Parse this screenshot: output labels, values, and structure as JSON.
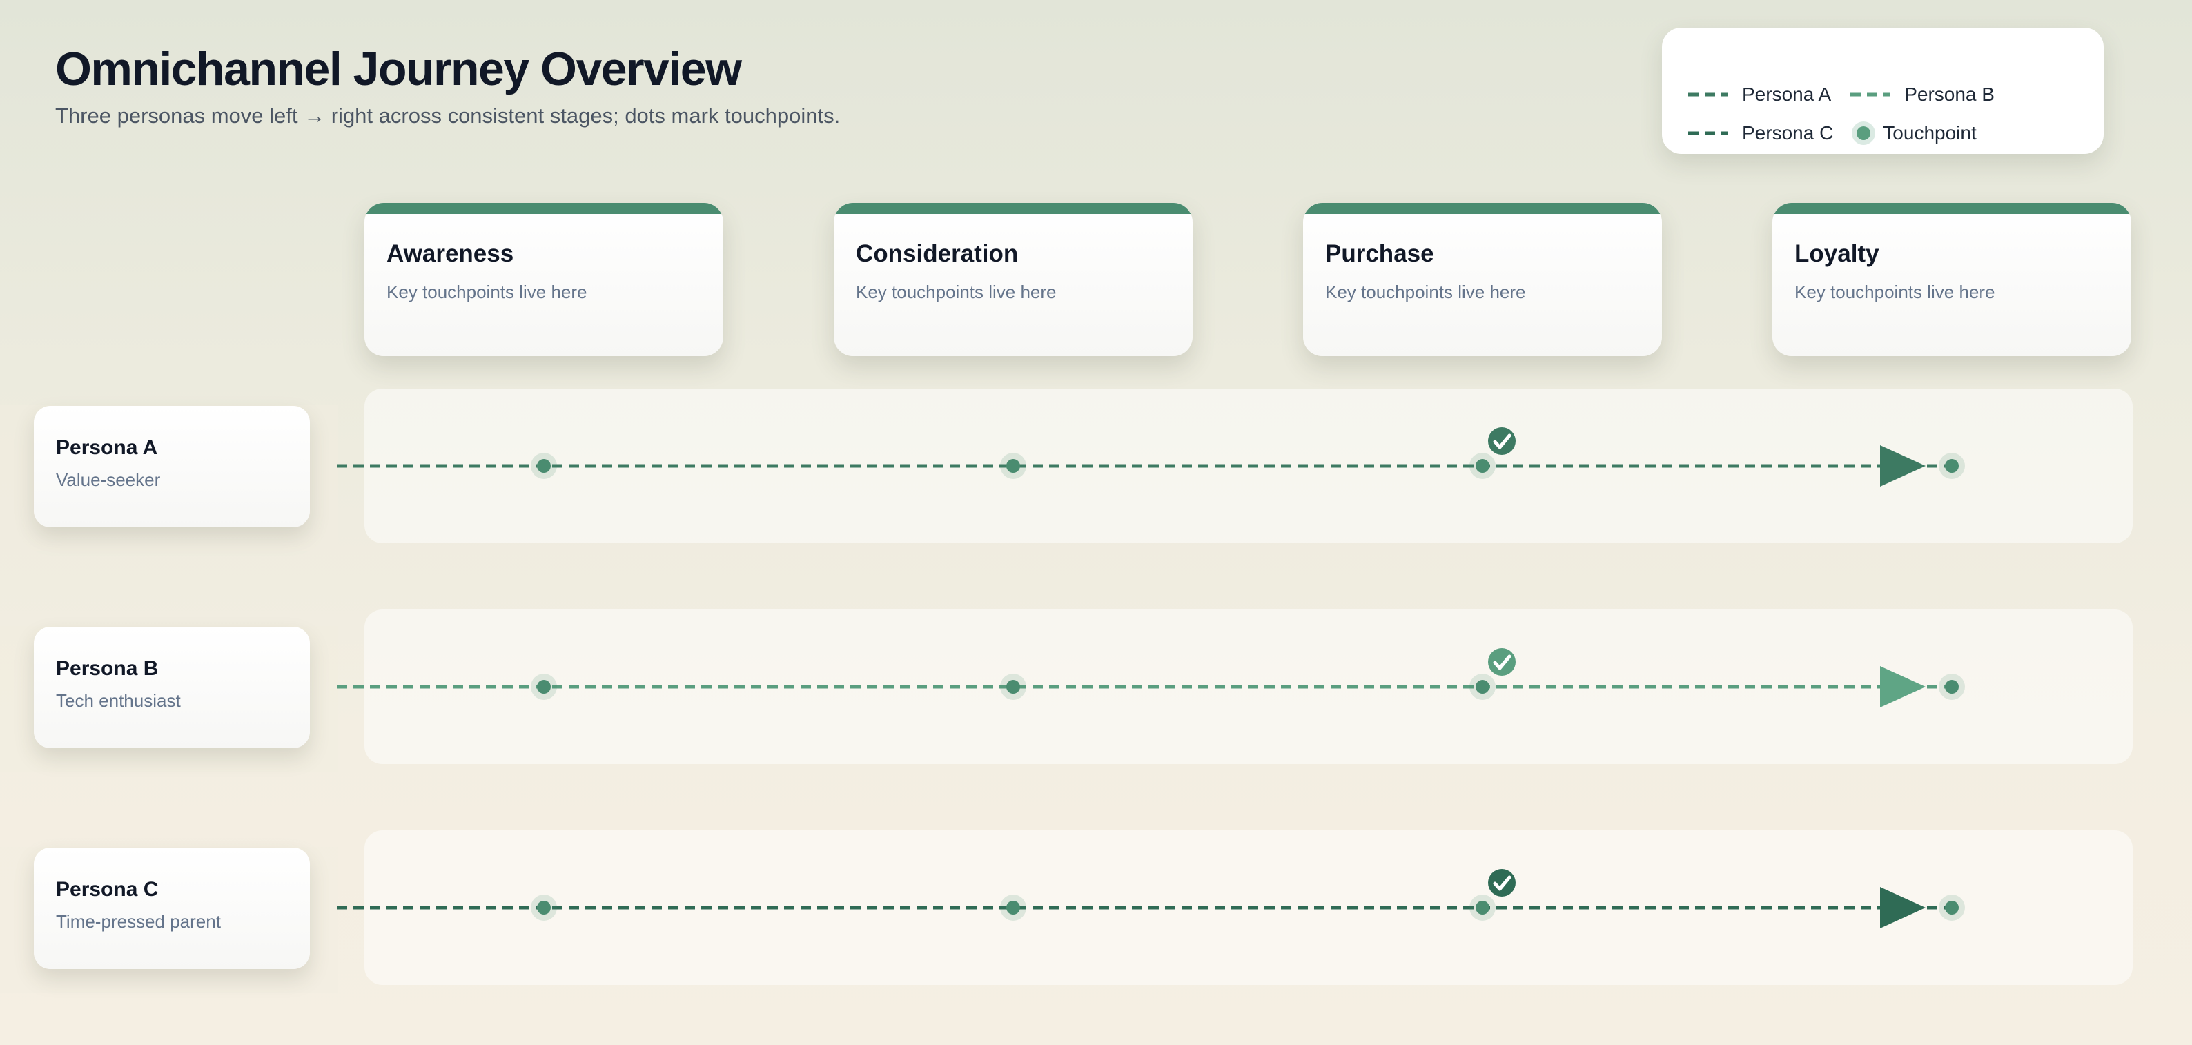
{
  "header": {
    "title": "Omnichannel Journey Overview",
    "subtitle": "Three personas move left → right across consistent stages; dots mark touchpoints."
  },
  "legend": {
    "items": [
      {
        "label": "Persona A",
        "kind": "line",
        "color": "#3d7a62"
      },
      {
        "label": "Persona B",
        "kind": "line",
        "color": "#5a9e7f"
      },
      {
        "label": "Persona C",
        "kind": "line",
        "color": "#2f6b55"
      },
      {
        "label": "Touchpoint",
        "kind": "dot",
        "color": "#5a9e7f"
      }
    ]
  },
  "stages": [
    {
      "name": "Awareness",
      "desc": "Key touchpoints live here"
    },
    {
      "name": "Consideration",
      "desc": "Key touchpoints live here"
    },
    {
      "name": "Purchase",
      "desc": "Key touchpoints live here"
    },
    {
      "name": "Loyalty",
      "desc": "Key touchpoints live here"
    }
  ],
  "personas": [
    {
      "name": "Persona A",
      "desc": "Value-seeker",
      "color": "#3d7a62",
      "arrow_color": "#3d7a62",
      "check_color": "#3d7a62",
      "completed_stage": "Purchase",
      "icons": [
        "check-circle-icon",
        "arrowhead-icon"
      ]
    },
    {
      "name": "Persona B",
      "desc": "Tech enthusiast",
      "color": "#5a9e7f",
      "arrow_color": "#5fa585",
      "check_color": "#5a9e7f",
      "completed_stage": "Purchase",
      "icons": [
        "check-circle-icon",
        "arrowhead-icon"
      ]
    },
    {
      "name": "Persona C",
      "desc": "Time-pressed parent",
      "color": "#2f6b55",
      "arrow_color": "#2f6b55",
      "check_color": "#2f6b55",
      "completed_stage": "Purchase",
      "icons": [
        "check-circle-icon",
        "arrowhead-icon"
      ]
    }
  ],
  "colors": {
    "accent": "#4a8c70",
    "touchpoint": "#4a8c70"
  }
}
